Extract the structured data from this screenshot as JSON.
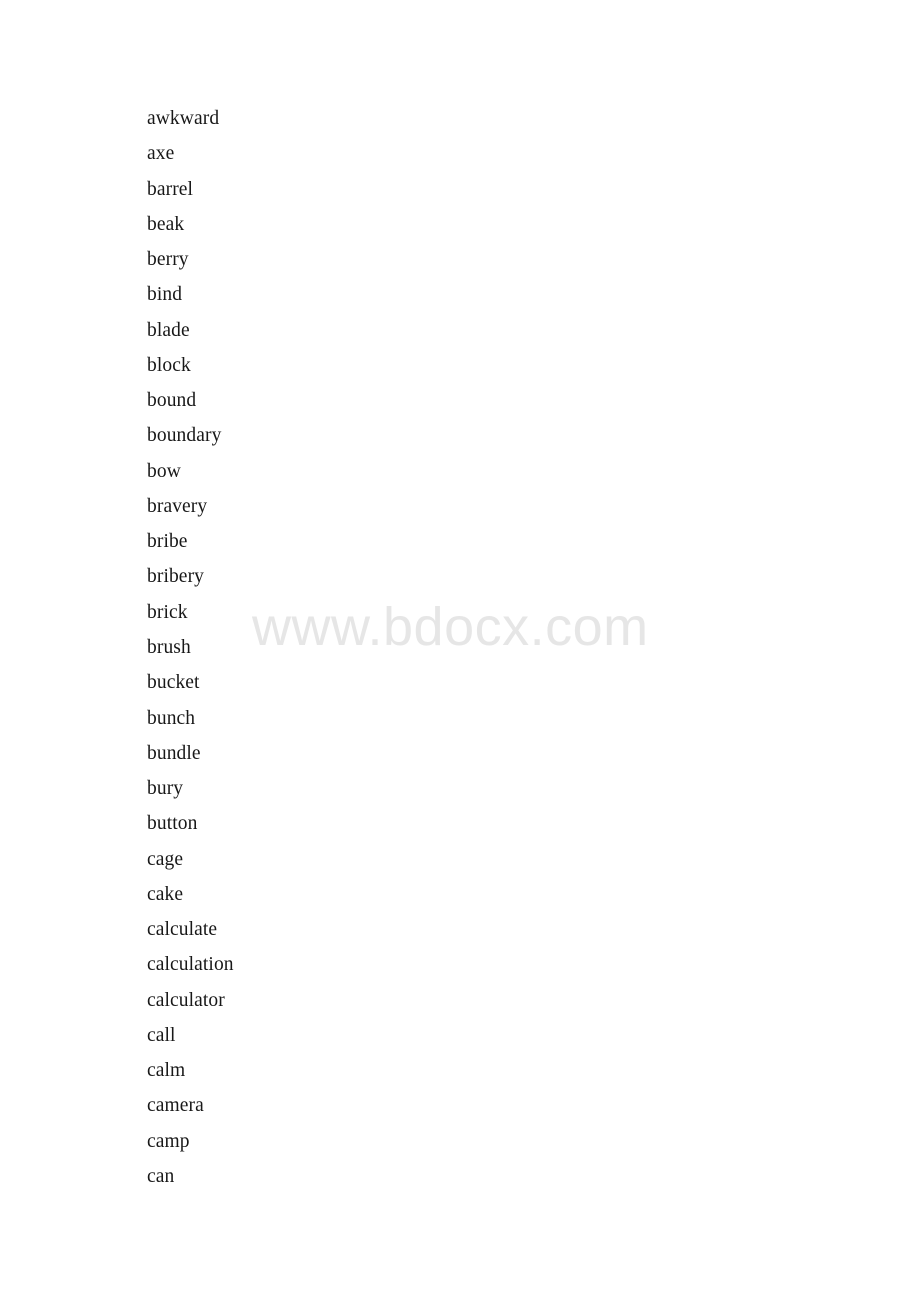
{
  "document": {
    "background_color": "#ffffff",
    "text_color": "#181818",
    "watermark": {
      "text": "www.bdocx.com",
      "color": "#e6e6e6"
    },
    "word_list": [
      "awkward",
      "axe",
      "barrel",
      "beak",
      "berry",
      "bind",
      "blade",
      "block",
      "bound",
      "boundary",
      "bow",
      "bravery",
      "bribe",
      "bribery",
      "brick",
      "brush",
      "bucket",
      "bunch",
      "bundle",
      "bury",
      "button",
      "cage",
      "cake",
      "calculate",
      "calculation",
      "calculator",
      "call",
      "calm",
      "camera",
      "camp",
      "can"
    ]
  }
}
